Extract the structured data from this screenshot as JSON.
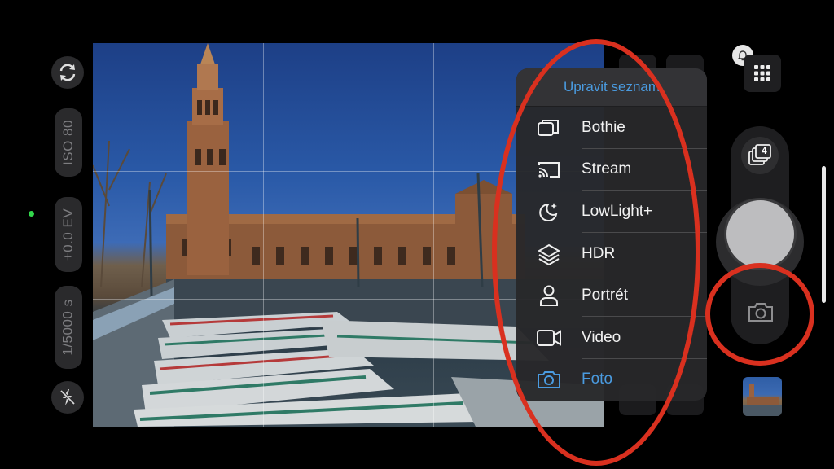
{
  "left_controls": {
    "iso": "ISO 80",
    "ev": "+0.0 EV",
    "shutter_speed": "1/5000 s",
    "icons": {
      "switch": "rotate-camera-icon",
      "flash": "flash-off-icon"
    }
  },
  "menu": {
    "header": "Upravit seznam",
    "items": [
      {
        "label": "Bothie",
        "icon": "bothie-icon",
        "active": false
      },
      {
        "label": "Stream",
        "icon": "cast-icon",
        "active": false
      },
      {
        "label": "LowLight+",
        "icon": "moon-sparkle-icon",
        "active": false
      },
      {
        "label": "HDR",
        "icon": "layers-icon",
        "active": false
      },
      {
        "label": "Portrét",
        "icon": "person-icon",
        "active": false
      },
      {
        "label": "Video",
        "icon": "video-camera-icon",
        "active": false
      },
      {
        "label": "Foto",
        "icon": "camera-icon",
        "active": true
      }
    ]
  },
  "right_controls": {
    "burst_count": "4",
    "icons": {
      "bell": "bell-icon",
      "grid": "grid-icon",
      "mode": "camera-icon"
    }
  },
  "colors": {
    "accent": "#4a9be0",
    "annotation": "#d9301f",
    "indicator": "#32d74b"
  }
}
